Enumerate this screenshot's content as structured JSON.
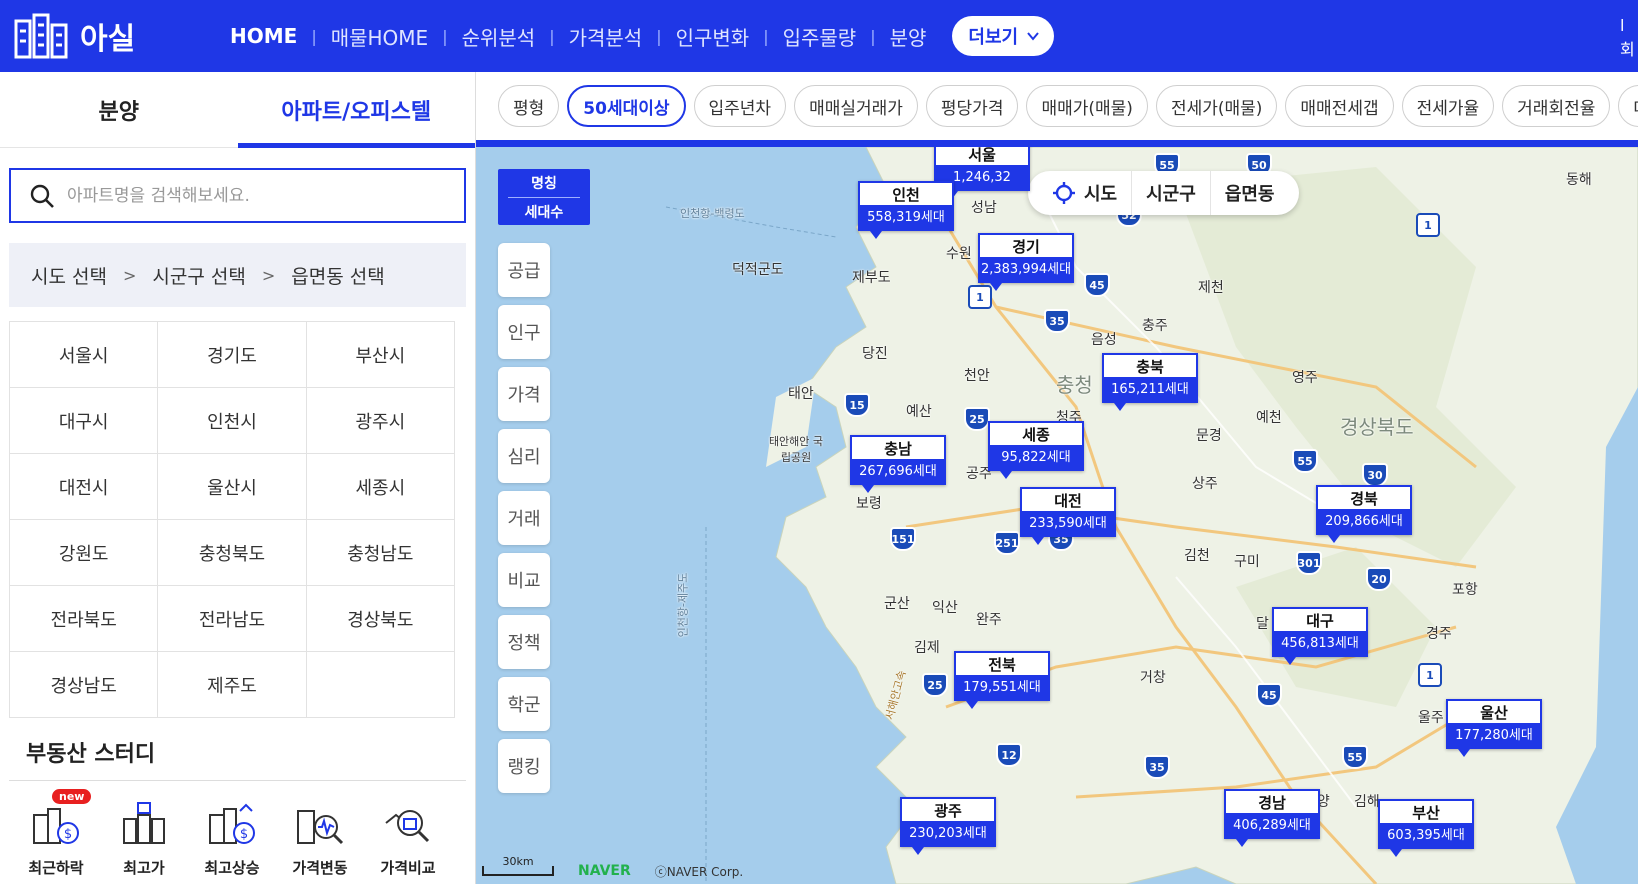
{
  "header": {
    "logo_text": "아실",
    "nav": [
      "HOME",
      "매물HOME",
      "순위분석",
      "가격분석",
      "인구변화",
      "입주물량",
      "분양"
    ],
    "more_label": "더보기",
    "right_partial": [
      "l",
      "회"
    ]
  },
  "left": {
    "tabs": [
      "분양",
      "아파트/오피스텔"
    ],
    "search_placeholder": "아파트명을 검색해보세요.",
    "breadcrumb": [
      "시도 선택",
      "시군구 선택",
      "읍면동 선택"
    ],
    "breadcrumb_sep": ">",
    "regions": [
      "서울시",
      "경기도",
      "부산시",
      "대구시",
      "인천시",
      "광주시",
      "대전시",
      "울산시",
      "세종시",
      "강원도",
      "충청북도",
      "충청남도",
      "전라북도",
      "전라남도",
      "경상북도",
      "경상남도",
      "제주도"
    ],
    "study_title": "부동산 스터디",
    "study_items": [
      "최근하락",
      "최고가",
      "최고상승",
      "가격변동",
      "가격비교"
    ],
    "new_badge": "new"
  },
  "chips": [
    "평형",
    "50세대이상",
    "입주년차",
    "매매실거래가",
    "평당가격",
    "매매가(매물)",
    "전세가(매물)",
    "매매전세갭",
    "전세가율",
    "거래회전율",
    "대지지"
  ],
  "map": {
    "side_head": [
      "명칭",
      "세대수"
    ],
    "side_buttons": [
      "공급",
      "인구",
      "가격",
      "심리",
      "거래",
      "비교",
      "정책",
      "학군",
      "랭킹"
    ],
    "level_tabs": [
      "시도",
      "시군구",
      "읍면동"
    ],
    "markers": [
      {
        "name": "서울",
        "count": "1,246,32"
      },
      {
        "name": "인천",
        "count": "558,319세대"
      },
      {
        "name": "경기",
        "count": "2,383,994세대"
      },
      {
        "name": "충북",
        "count": "165,211세대"
      },
      {
        "name": "세종",
        "count": "95,822세대"
      },
      {
        "name": "충남",
        "count": "267,696세대"
      },
      {
        "name": "대전",
        "count": "233,590세대"
      },
      {
        "name": "경북",
        "count": "209,866세대"
      },
      {
        "name": "대구",
        "count": "456,813세대"
      },
      {
        "name": "전북",
        "count": "179,551세대"
      },
      {
        "name": "울산",
        "count": "177,280세대"
      },
      {
        "name": "광주",
        "count": "230,203세대"
      },
      {
        "name": "경남",
        "count": "406,289세대"
      },
      {
        "name": "부산",
        "count": "603,395세대"
      }
    ],
    "places": [
      "성남",
      "수원",
      "덕적군도",
      "제부도",
      "제천",
      "충주",
      "음성",
      "당진",
      "천안",
      "충청",
      "영주",
      "태안",
      "예산",
      "청주",
      "문경",
      "예천",
      "경상북도",
      "태안해안 국립공원",
      "공주",
      "상주",
      "보령",
      "김천",
      "구미",
      "포항",
      "군산",
      "익산",
      "완주",
      "달",
      "경주",
      "김제",
      "거창",
      "울주",
      "김해",
      "밀양",
      "동해",
      "인천항-백령도",
      "인천항-제주도",
      "서해안고속"
    ],
    "highways": [
      "55",
      "50",
      "52",
      "1",
      "45",
      "35",
      "15",
      "25",
      "55",
      "30",
      "151",
      "251",
      "35",
      "301",
      "20",
      "25",
      "45",
      "1",
      "12",
      "35",
      "55",
      "1"
    ],
    "scale": "30km",
    "naver": "NAVER",
    "copyright": "ⓒNAVER Corp."
  }
}
